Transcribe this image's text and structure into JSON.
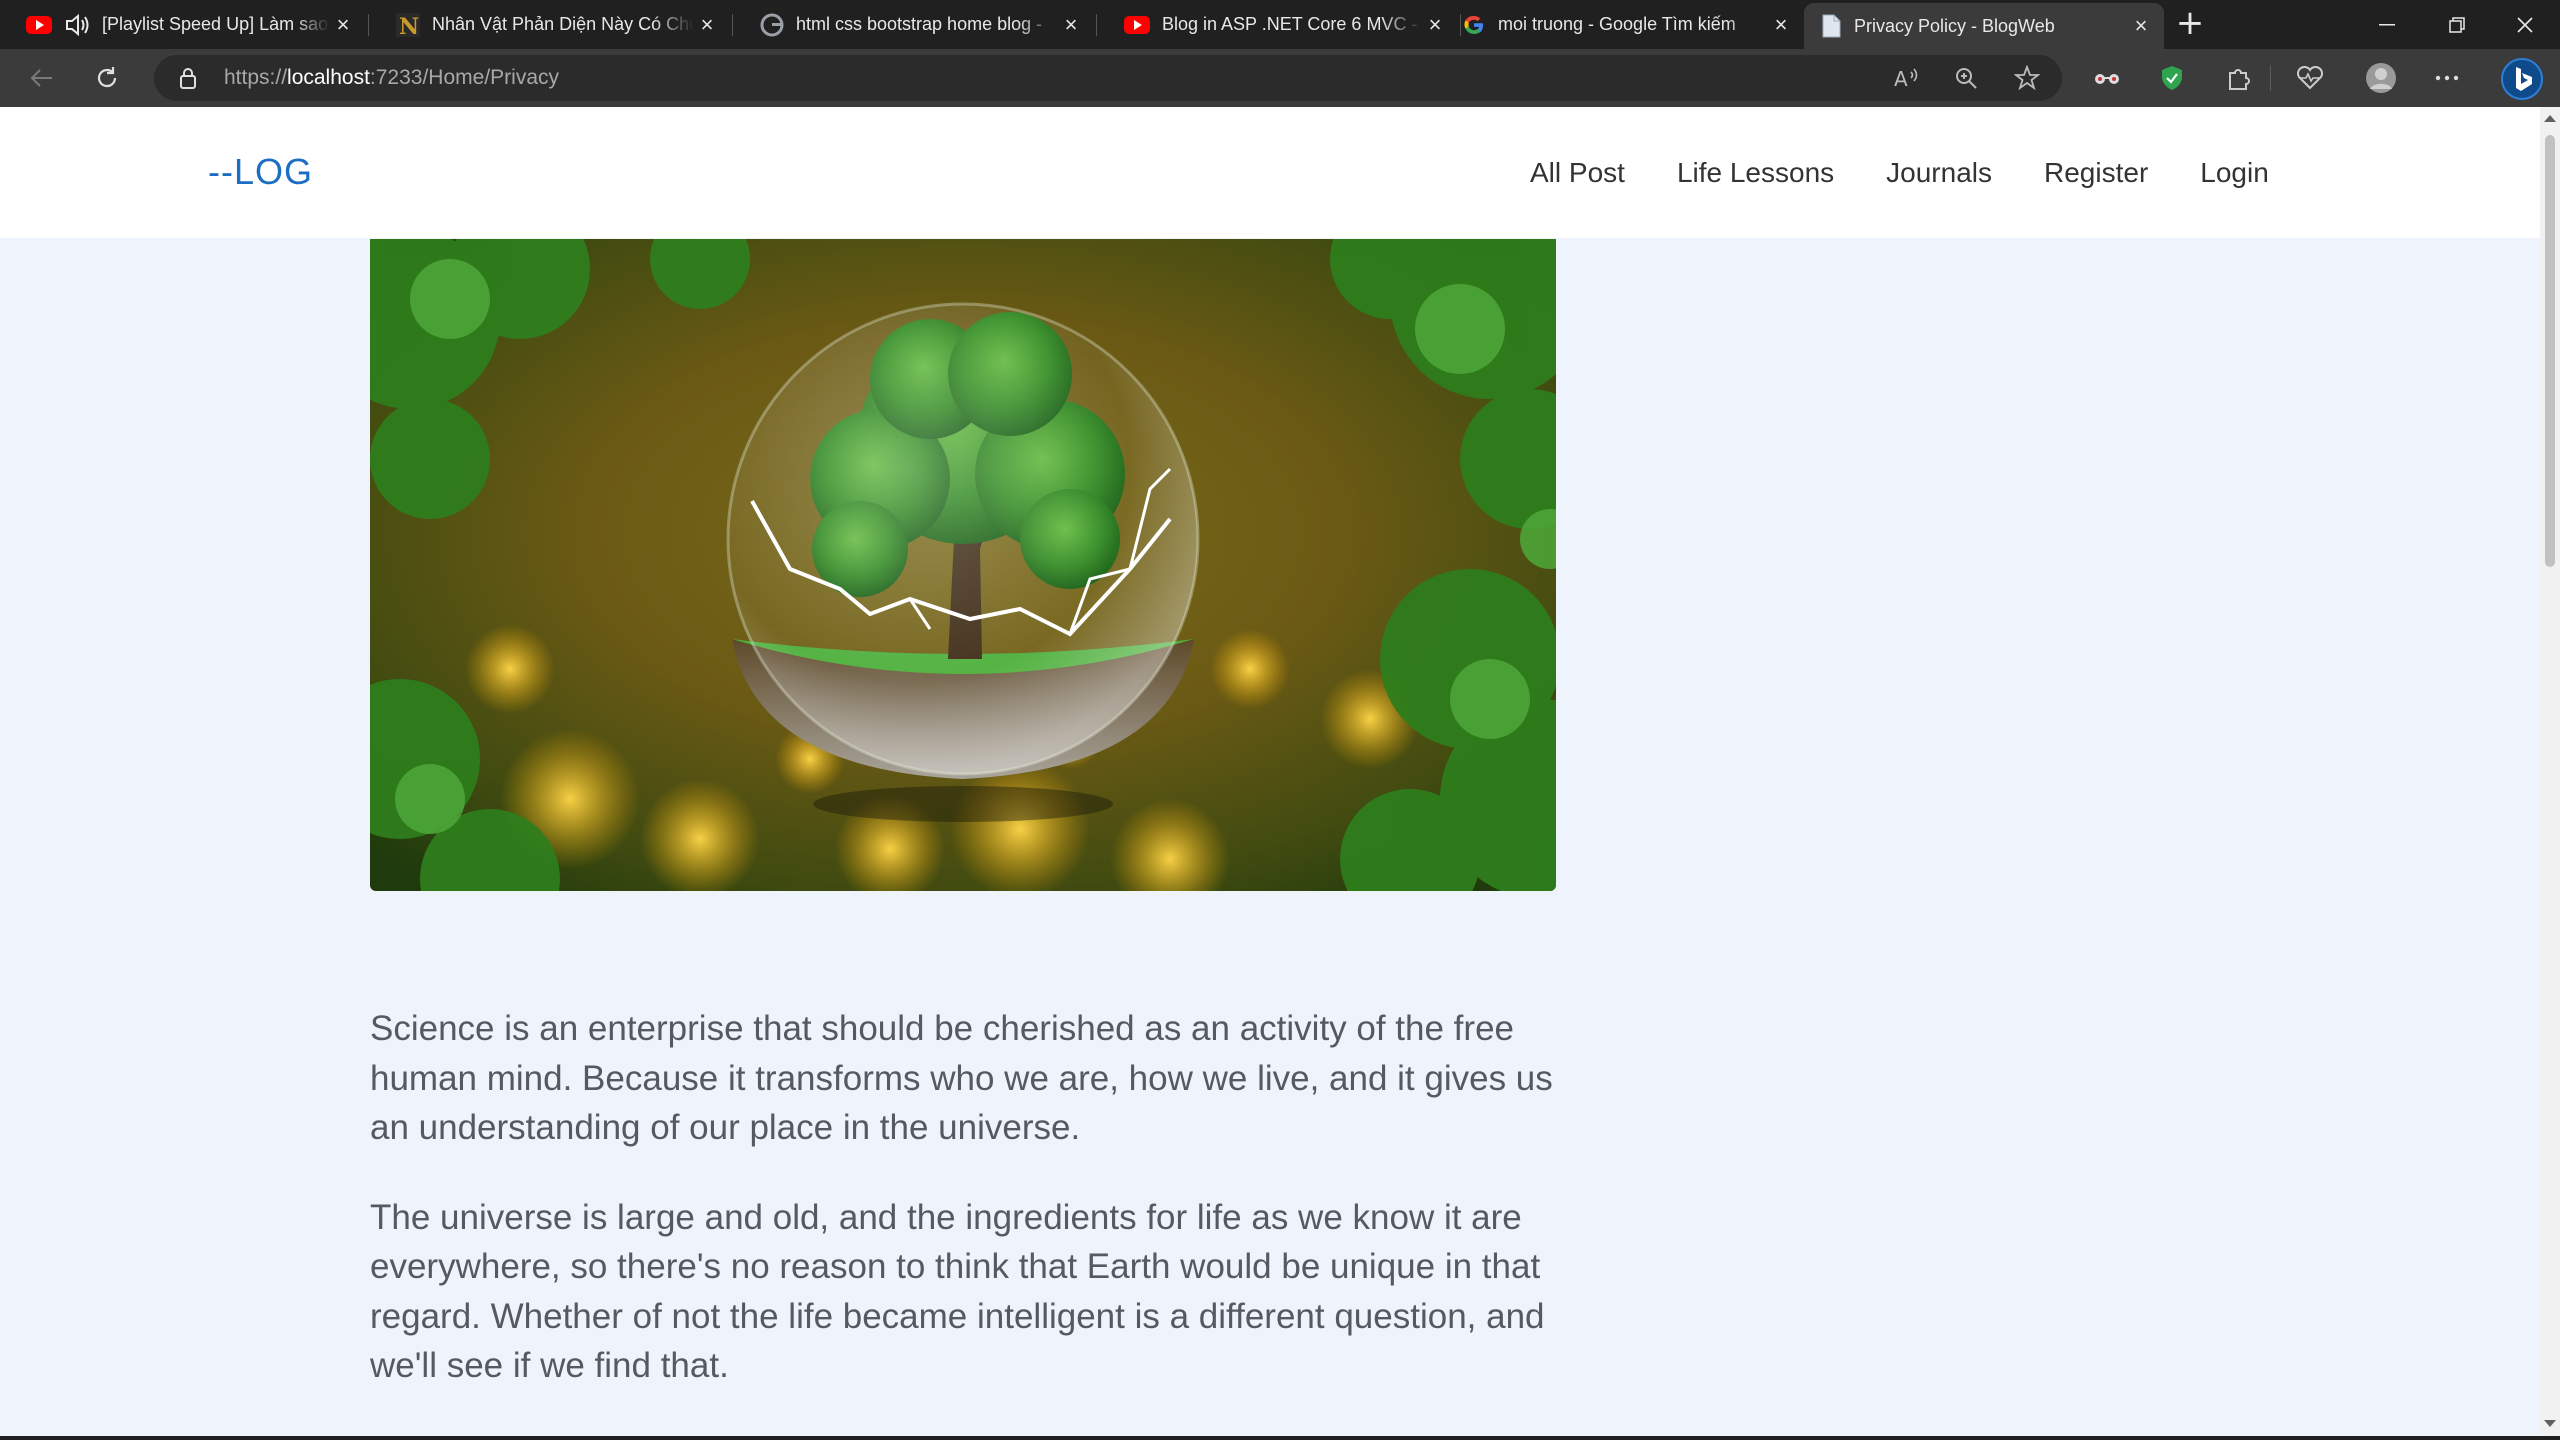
{
  "browser": {
    "tabs": [
      {
        "title": "[Playlist Speed Up] Làm sao",
        "favicon": "youtube-icon",
        "audio": true
      },
      {
        "title": "Nhân Vật Phản Diện Này Có Chú",
        "favicon": "novel-site-icon"
      },
      {
        "title": "html css bootstrap home blog -",
        "favicon": "google-icon"
      },
      {
        "title": "Blog in ASP .NET Core 6 MVC - Y",
        "favicon": "youtube-icon"
      },
      {
        "title": "moi truong - Google Tìm kiếm",
        "favicon": "google-icon"
      },
      {
        "title": "Privacy Policy - BlogWeb",
        "favicon": "page-icon",
        "active": true
      }
    ],
    "address": {
      "scheme": "https://",
      "host": "localhost",
      "rest": ":7233/Home/Privacy"
    }
  },
  "site": {
    "logo": "--LOG",
    "nav": [
      "All Post",
      "Life Lessons",
      "Journals",
      "Register",
      "Login"
    ]
  },
  "hero_image": {
    "description": "crystal ball with tree",
    "icon": "environment-hero-image"
  },
  "content": {
    "paragraphs": [
      "Science is an enterprise that should be cherished as an activity of the free human mind. Because it transforms who we are, how we live, and it gives us an understanding of our place in the universe.",
      "The universe is large and old, and the ingredients for life as we know it are everywhere, so there's no reason to think that Earth would be unique in that regard. Whether of not the life became intelligent is a different question, and we'll see if we find that."
    ]
  },
  "colors": {
    "brand": "#1b6ec2",
    "page_bg": "#eff3fb",
    "text": "#555a5e",
    "browser_dark": "#202020"
  }
}
